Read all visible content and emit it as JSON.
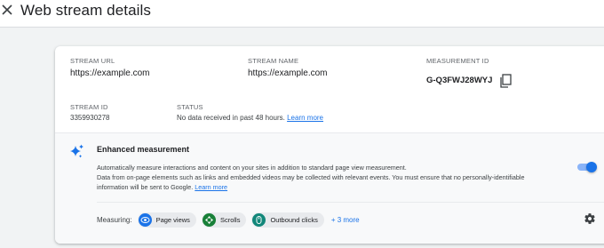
{
  "header": {
    "title": "Web stream details"
  },
  "stream": {
    "url_label": "STREAM URL",
    "url_value": "https://example.com",
    "name_label": "STREAM NAME",
    "name_value": "https://example.com",
    "measurement_label": "MEASUREMENT ID",
    "measurement_value": "G-Q3FWJ28WYJ",
    "id_label": "STREAM ID",
    "id_value": "3359930278",
    "status_label": "STATUS",
    "status_value": "No data received in past 48 hours.",
    "status_link": "Learn more"
  },
  "enhanced": {
    "title": "Enhanced measurement",
    "desc_line1": "Automatically measure interactions and content on your sites in addition to standard page view measurement.",
    "desc_line2": "Data from on-page elements such as links and embedded videos may be collected with relevant events. You must ensure that no personally-identifiable",
    "desc_line3": "information will be sent to Google.",
    "desc_link": "Learn more",
    "toggle_on": true,
    "measuring_label": "Measuring:",
    "chips": [
      {
        "label": "Page views",
        "icon": "eye-icon",
        "color": "#1a73e8"
      },
      {
        "label": "Scrolls",
        "icon": "scroll-icon",
        "color": "#188038"
      },
      {
        "label": "Outbound clicks",
        "icon": "mouse-icon",
        "color": "#12877a"
      }
    ],
    "more": "+ 3 more"
  },
  "colors": {
    "accent": "#1a73e8",
    "toggle_track": "#8ab4f8"
  }
}
